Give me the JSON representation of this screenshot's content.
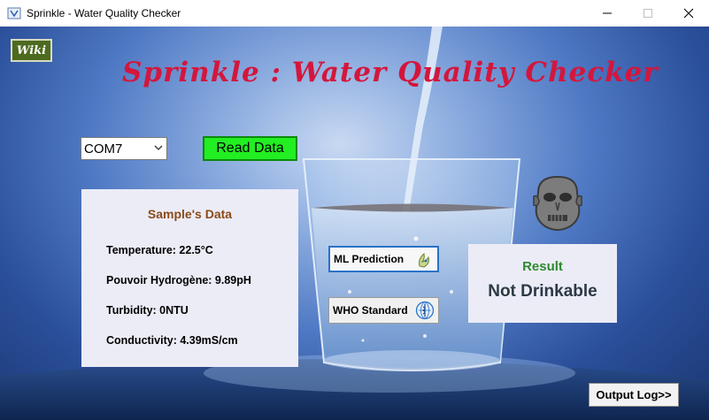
{
  "window": {
    "title": "Sprinkle - Water Quality Checker"
  },
  "wiki_button": {
    "label": "Wiki"
  },
  "app_title": "Sprinkle : Water Quality Checker",
  "port_select": {
    "value": "COM7"
  },
  "read_button": {
    "label": "Read Data"
  },
  "sample": {
    "title": "Sample's Data",
    "rows": [
      "Temperature: 22.5°C",
      "Pouvoir Hydrogène: 9.89pH",
      "Turbidity: 0NTU",
      "Conductivity: 4.39mS/cm"
    ]
  },
  "ml_button": {
    "label": "ML Prediction",
    "icon": "ml-icon"
  },
  "who_button": {
    "label": "WHO Standard",
    "icon": "who-emblem-icon"
  },
  "result": {
    "label": "Result",
    "value": "Not Drinkable",
    "icon": "sad-face-icon"
  },
  "output_button": {
    "label": "Output Log>>"
  },
  "colors": {
    "title_red": "#d4163c",
    "read_green": "#22ee22",
    "result_green": "#2f8a2f",
    "sample_brown": "#8a4b16",
    "ml_border_blue": "#2a72c9"
  }
}
